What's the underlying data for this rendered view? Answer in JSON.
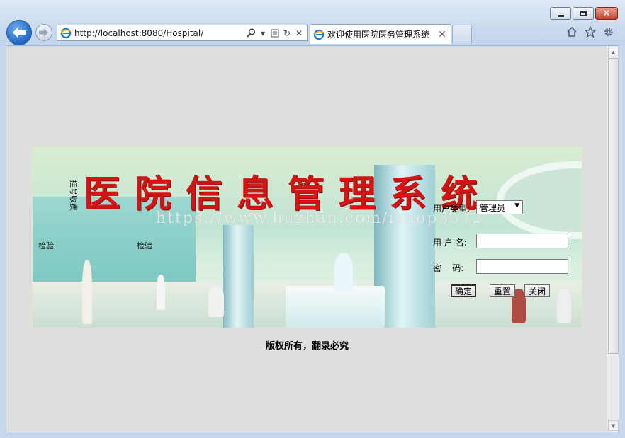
{
  "browser": {
    "address": "http://localhost:8080/Hospital/",
    "tab_title": "欢迎使用医院医务管理系统"
  },
  "banner": {
    "title": "医院信息管理系统",
    "watermark": "https://www.huzhan.com/ishop3572",
    "signs": [
      "挂号收费",
      "检验",
      "检验"
    ]
  },
  "login": {
    "user_type_label": "用户类型:",
    "user_type_value": "管理员",
    "username_label": "用 户 名:",
    "username_value": "",
    "password_label": "密    码:",
    "password_value": "",
    "confirm_label": "确定",
    "reset_label": "重置",
    "close_label": "关闭"
  },
  "footer": {
    "copyright": "版权所有，翻录必究"
  },
  "icons": {
    "back": "back-arrow-icon",
    "forward": "forward-arrow-icon",
    "search": "search-icon",
    "compat": "compatibility-view-icon",
    "refresh": "refresh-icon",
    "stop": "stop-icon",
    "home": "home-icon",
    "favorites": "star-icon",
    "tools": "gear-icon"
  }
}
